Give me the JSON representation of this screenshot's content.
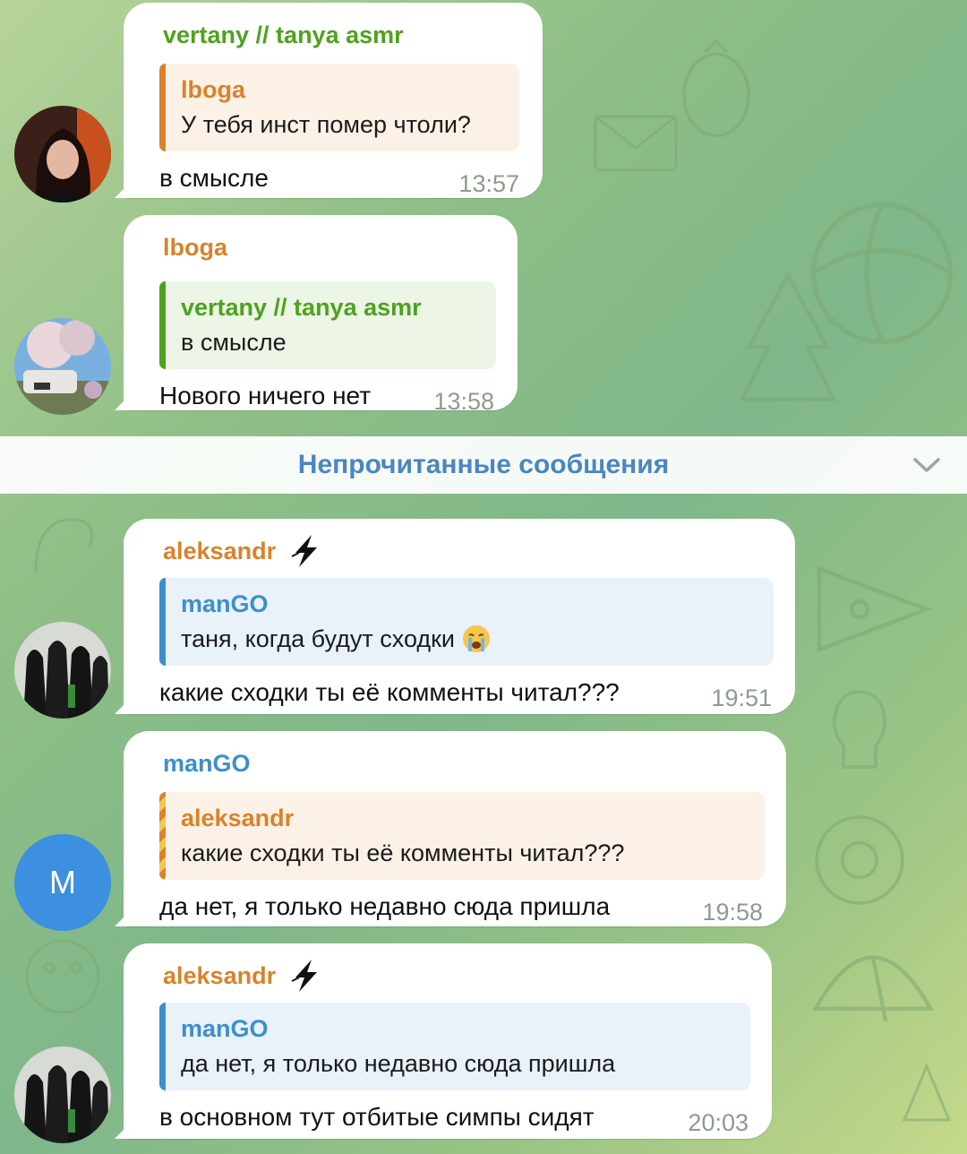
{
  "messages": [
    {
      "sender": "vertany // tanya asmr",
      "reply_to": {
        "name": "lboga",
        "text": "У тебя инст помер чтоли?"
      },
      "text": "в смысле",
      "time": "13:57"
    },
    {
      "sender": "lboga",
      "reply_to": {
        "name": "vertany // tanya asmr",
        "text": "в смысле"
      },
      "text": "Нового ничего нет",
      "time": "13:58"
    },
    {
      "sender": "aleksandr",
      "reply_to": {
        "name": "manGO",
        "text": "таня, когда будут сходки"
      },
      "text": "какие сходки ты её комменты читал???",
      "time": "19:51"
    },
    {
      "sender": "manGO",
      "avatar_letter": "M",
      "reply_to": {
        "name": "aleksandr",
        "text": "какие сходки ты её комменты читал???"
      },
      "text": "да нет, я только недавно сюда пришла",
      "time": "19:58"
    },
    {
      "sender": "aleksandr",
      "reply_to": {
        "name": "manGO",
        "text": "да нет, я только недавно сюда пришла"
      },
      "text": "в основном тут отбитые симпы сидят",
      "time": "20:03"
    }
  ],
  "unread_divider": {
    "label": "Непрочитанные сообщения"
  },
  "icons": {
    "badge": "lightning-bolt-icon",
    "emoji": "crying-face-emoji-icon",
    "scroll": "chevron-down-icon"
  },
  "colors": {
    "name_green": "#4ea21e",
    "name_orange": "#d9822b",
    "name_blue": "#3c8fcb",
    "unread_text": "#4b86c0",
    "avatar_blue": "#3d8fe0"
  }
}
